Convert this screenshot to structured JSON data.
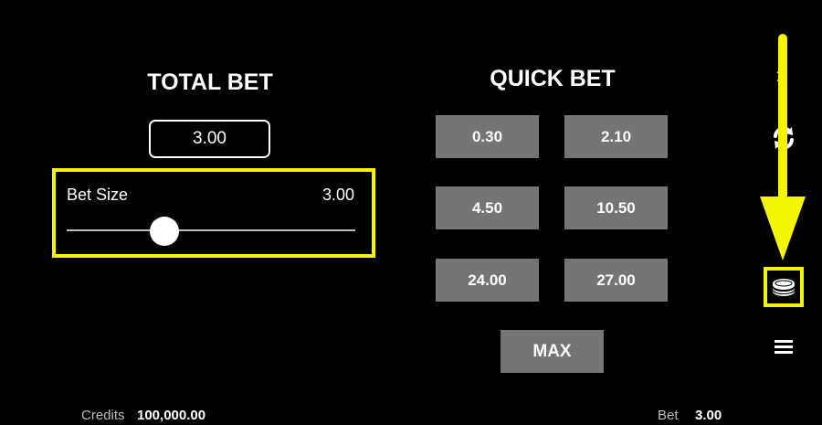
{
  "total_bet": {
    "title": "TOTAL BET",
    "value": "3.00"
  },
  "bet_size": {
    "label": "Bet Size",
    "value": "3.00",
    "slider_fraction": 0.34
  },
  "quick_bet": {
    "title": "QUICK BET",
    "options": [
      "0.30",
      "2.10",
      "4.50",
      "10.50",
      "24.00",
      "27.00"
    ],
    "max_label": "MAX"
  },
  "sidebar": {
    "icons": [
      "close-icon",
      "refresh-icon",
      "coins-icon",
      "menu-icon"
    ],
    "highlight_color": "#f5f500"
  },
  "footer": {
    "credits_label": "Credits",
    "credits_value": "100,000.00",
    "bet_label": "Bet",
    "bet_value": "3.00"
  },
  "colors": {
    "background": "#000000",
    "button": "#757575",
    "highlight": "#f5f500"
  }
}
